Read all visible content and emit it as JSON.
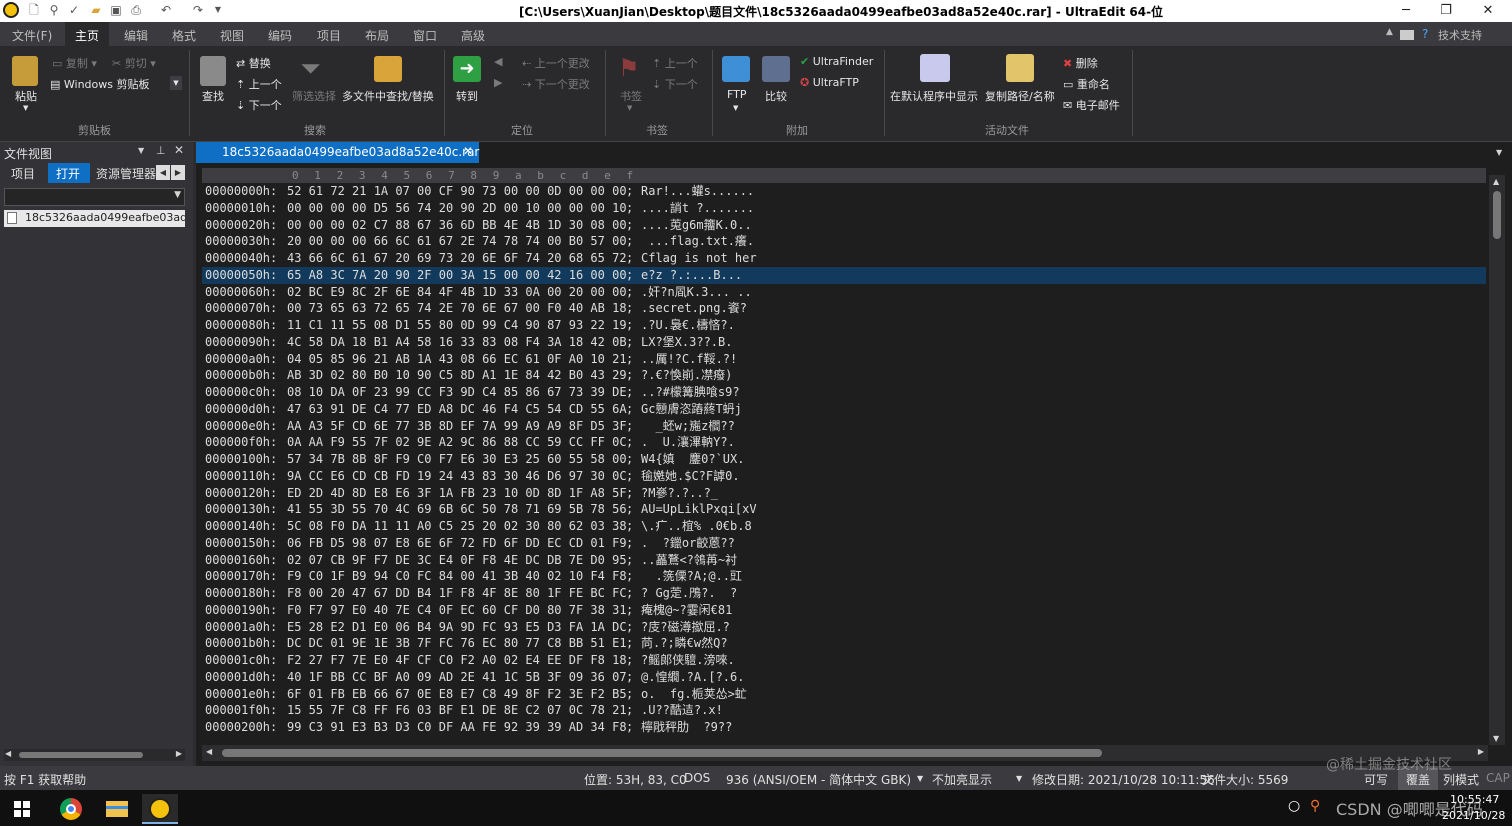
{
  "window": {
    "title": "[C:\\Users\\XuanJian\\Desktop\\题目文件\\18c5326aada0499eafbe03ad8a52e40c.rar] - UltraEdit 64-位",
    "controls": {
      "minimize": "─",
      "maximize": "❐",
      "close": "✕"
    }
  },
  "menu": {
    "items": [
      "文件(F)",
      "主页",
      "编辑",
      "格式",
      "视图",
      "编码",
      "项目",
      "布局",
      "窗口",
      "高级"
    ],
    "active": "主页",
    "right_help": "技术支持"
  },
  "ribbon": {
    "clipboard": {
      "paste": "粘贴",
      "copy": "复制",
      "cut": "剪切",
      "windows_clipboard": "Windows 剪贴板",
      "group": "剪贴板"
    },
    "search": {
      "find": "查找",
      "replace": "替换",
      "prev": "上一个",
      "next": "下一个",
      "filter": "筛选选择",
      "multi_file": "多文件中查找/替换",
      "group": "搜索"
    },
    "navigate": {
      "goto": "转到",
      "prev_change": "上一个更改",
      "next_change": "下一个更改",
      "group": "定位"
    },
    "bookmark": {
      "bookmark": "书签",
      "prev": "上一个",
      "next": "下一个",
      "group": "书签"
    },
    "addons": {
      "ftp": "FTP",
      "compare": "比较",
      "ultrafinder": "UltraFinder",
      "ultraftp": "UltraFTP",
      "group": "附加"
    },
    "active_file": {
      "show_default": "在默认程序中显示",
      "copy_path": "复制路径/名称",
      "delete": "删除",
      "rename": "重命名",
      "email": "电子邮件",
      "group": "活动文件"
    }
  },
  "file_view": {
    "title": "文件视图",
    "tabs": [
      "项目",
      "打开",
      "资源管理器"
    ],
    "active_tab": "打开",
    "files": [
      "18c5326aada0499eafbe03ad8a52e40c.rar"
    ]
  },
  "editor": {
    "tab": "18c5326aada0499eafbe03ad8a52e40c.rar",
    "ruler": [
      "0",
      "1",
      "2",
      "3",
      "4",
      "5",
      "6",
      "7",
      "8",
      "9",
      "a",
      "b",
      "c",
      "d",
      "e",
      "f"
    ],
    "selected_row": 5,
    "rows": [
      {
        "addr": "00000000h:",
        "hex": "52 61 72 21 1A 07 00 CF 90 73 00 00 0D 00 00 00",
        "sep": ";",
        "text": "Rar!...蠸s......"
      },
      {
        "addr": "00000010h:",
        "hex": "00 00 00 00 D5 56 74 20 90 2D 00 10 00 00 00 10",
        "sep": ";",
        "text": "....誚t ?......."
      },
      {
        "addr": "00000020h:",
        "hex": "00 00 00 02 C7 88 67 36 6D BB 4E 4B 1D 30 08 00",
        "sep": ";",
        "text": "....莵g6m籒K.0.."
      },
      {
        "addr": "00000030h:",
        "hex": "20 00 00 00 66 6C 61 67 2E 74 78 74 00 B0 57 00",
        "sep": ";",
        "text": " ...flag.txt.癢."
      },
      {
        "addr": "00000040h:",
        "hex": "43 66 6C 61 67 20 69 73 20 6E 6F 74 20 68 65 72",
        "sep": ";",
        "text": "Cflag is not her"
      },
      {
        "addr": "00000050h:",
        "hex": "65 A8 3C 7A 20 90 2F 00 3A 15 00 00 42 16 00 00",
        "sep": ";",
        "text": "e?z ?.:...B..."
      },
      {
        "addr": "00000060h:",
        "hex": "02 BC E9 8C 2F 6E 84 4F 4B 1D 33 0A 00 20 00 00",
        "sep": ";",
        "text": ".奸?n凮K.3... .."
      },
      {
        "addr": "00000070h:",
        "hex": "00 73 65 63 72 65 74 2E 70 6E 67 00 F0 40 AB 18",
        "sep": ";",
        "text": ".secret.png.餈?"
      },
      {
        "addr": "00000080h:",
        "hex": "11 C1 11 55 08 D1 55 80 0D 99 C4 90 87 93 22 19",
        "sep": ";",
        "text": ".?U.裊€.檮悋?."
      },
      {
        "addr": "00000090h:",
        "hex": "4C 58 DA 18 B1 A4 58 16 33 83 08 F4 3A 18 42 0B",
        "sep": ";",
        "text": "LX?堡X.3??.B."
      },
      {
        "addr": "000000a0h:",
        "hex": "04 05 85 96 21 AB 1A 43 08 66 EC 61 0F A0 10 21",
        "sep": ";",
        "text": "..厲!?C.f鞖.?!"
      },
      {
        "addr": "000000b0h:",
        "hex": "AB 3D 02 80 B0 10 90 C5 8D A1 1E 84 42 B0 43 29",
        "sep": ";",
        "text": "?.€?愌崱.凚癈)"
      },
      {
        "addr": "000000c0h:",
        "hex": "08 10 DA 0F 23 99 CC F3 9D C4 85 86 67 73 39 DE",
        "sep": ";",
        "text": "..?#檬篝腆喰s9?"
      },
      {
        "addr": "000000d0h:",
        "hex": "47 63 91 DE C4 77 ED A8 DC 46 F4 C5 54 CD 55 6A",
        "sep": ";",
        "text": "Gc戅膚恣蹖蔠T蚒j"
      },
      {
        "addr": "000000e0h:",
        "hex": "AA A3 5F CD 6E 77 3B 8D EF 7A 99 A9 A9 8F D5 3F",
        "sep": ";",
        "text": "  _蚽w;崺z櫩??"
      },
      {
        "addr": "000000f0h:",
        "hex": "0A AA F9 55 7F 02 9E A2 9C 86 88 CC 59 CC FF 0C",
        "sep": ";",
        "text": ".  U.瀼滭軜Y?."
      },
      {
        "addr": "00000100h:",
        "hex": "57 34 7B 8B 8F F9 C0 F7 E6 30 E3 25 60 55 58 00",
        "sep": ";",
        "text": "W4{嫃  鏖0?`UX."
      },
      {
        "addr": "00000110h:",
        "hex": "9A CC E6 CD CB FD 19 24 43 83 30 46 D6 97 30 0C",
        "sep": ";",
        "text": "毺嬎她.$C?F謼0."
      },
      {
        "addr": "00000120h:",
        "hex": "ED 2D 4D 8D E8 E6 3F 1A FB 23 10 0D 8D 1F A8 5F",
        "sep": ";",
        "text": "?M嵾?.?..?_"
      },
      {
        "addr": "00000130h:",
        "hex": "41 55 3D 55 70 4C 69 6B 6C 50 78 71 69 5B 78 56",
        "sep": ";",
        "text": "AU=UpLiklPxqi[xV"
      },
      {
        "addr": "00000140h:",
        "hex": "5C 08 F0 DA 11 11 A0 C5 25 20 02 30 80 62 03 38",
        "sep": ";",
        "text": "\\.疒..椬% .0€b.8"
      },
      {
        "addr": "00000150h:",
        "hex": "06 FB D5 98 07 E8 6E 6F 72 FD 6F DD EC CD 01 F9",
        "sep": ";",
        "text": ".  ?鑞or齩蒽??"
      },
      {
        "addr": "00000160h:",
        "hex": "02 07 CB 9F F7 DE 3C E4 0F F8 4E DC DB 7E D0 95",
        "sep": ";",
        "text": "..藟鶩<?鴒苒~衬"
      },
      {
        "addr": "00000170h:",
        "hex": "F9 C0 1F B9 94 C0 FC 84 00 41 3B 40 02 10 F4 F8",
        "sep": ";",
        "text": "  .箲傈?A;@..豇"
      },
      {
        "addr": "00000180h:",
        "hex": "F8 00 20 47 67 DD B4 1F F8 4F 8E 80 1F FE BC FC",
        "sep": ";",
        "text": "? Gg萣.鳲?.  ?"
      },
      {
        "addr": "00000190h:",
        "hex": "F0 F7 97 E0 40 7E C4 0F EC 60 CF D0 80 7F 38 31",
        "sep": ";",
        "text": "痷槐@~?霎闲€81"
      },
      {
        "addr": "000001a0h:",
        "hex": "E5 28 E2 D1 E0 06 B4 9A 9D FC 93 E5 D3 FA 1A DC",
        "sep": ";",
        "text": "?庋?磁澊撳屈.?"
      },
      {
        "addr": "000001b0h:",
        "hex": "DC DC 01 9E 1E 3B 7F FC 76 EC 80 77 C8 BB 51 E1",
        "sep": ";",
        "text": "苘.?;瞵€w然Q?"
      },
      {
        "addr": "000001c0h:",
        "hex": "F2 27 F7 7E E0 4F CF C0 F2 A0 02 E4 EE DF F8 18",
        "sep": ";",
        "text": "?鳐郞侠驙.滂唻."
      },
      {
        "addr": "000001d0h:",
        "hex": "40 1F BB CC BF A0 09 AD 2E 41 1C 5B 3F 09 36 07",
        "sep": ";",
        "text": "@.惶繝.?A.[?.6."
      },
      {
        "addr": "000001e0h:",
        "hex": "6F 01 FB EB 66 67 0E E8 E7 C8 49 8F F2 3E F2 B5",
        "sep": ";",
        "text": "o.  fg.栀荚怂>虻"
      },
      {
        "addr": "000001f0h:",
        "hex": "15 55 7F C8 FF F6 03 BF E1 DE 8E C2 07 0C 78 21",
        "sep": ";",
        "text": ".U??酷迼?.x!"
      },
      {
        "addr": "00000200h:",
        "hex": "99 C3 91 E3 B3 D3 C0 DF AA FE 92 39 39 AD 34 F8",
        "sep": ";",
        "text": "檸戙秤肋  ?9??"
      }
    ]
  },
  "status": {
    "help": "按 F1 获取帮助",
    "position": "位置: 53H, 83, C0",
    "line_ending": "DOS",
    "codepage": "936   (ANSI/OEM - 简体中文 GBK)",
    "highlight": "不加亮显示",
    "modified": "修改日期: 2021/10/28 10:11:56",
    "size": "文件大小: 5569",
    "writable": "可写",
    "overwrite": "覆盖",
    "column_mode": "列模式",
    "caps": "CAP"
  },
  "taskbar": {
    "time": "10:55:47",
    "date": "2021/10/28",
    "watermark": "@稀土掘金技术社区",
    "watermark2": "CSDN @唧唧是代码"
  },
  "colors": {
    "accent": "#0e6fc5",
    "editor_bg": "#1e1e1e",
    "selected_row": "#123a5c"
  }
}
